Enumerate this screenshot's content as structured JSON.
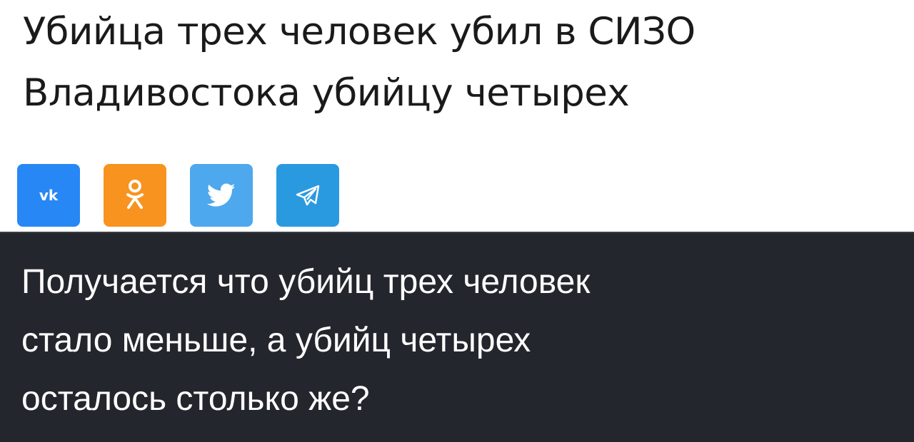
{
  "article": {
    "headline_lines": [
      "Убийца трех человек убил в СИЗО",
      "Владивостока убийцу четырех"
    ]
  },
  "share": {
    "buttons": [
      {
        "network": "vk",
        "icon": "vk-icon",
        "label": "vk",
        "color": "#2787f5"
      },
      {
        "network": "odnoklassniki",
        "icon": "odnoklassniki-icon",
        "color": "#f7931e"
      },
      {
        "network": "twitter",
        "icon": "twitter-bird-icon",
        "color": "#4ea8ee"
      },
      {
        "network": "telegram",
        "icon": "telegram-plane-icon",
        "color": "#2a9ae0"
      }
    ]
  },
  "comment": {
    "lines": [
      "Получается что убийц трех человек",
      "стало меньше, а убийц четырех",
      "осталось столько же?"
    ],
    "background": "#24262d",
    "text_color": "#ffffff"
  }
}
